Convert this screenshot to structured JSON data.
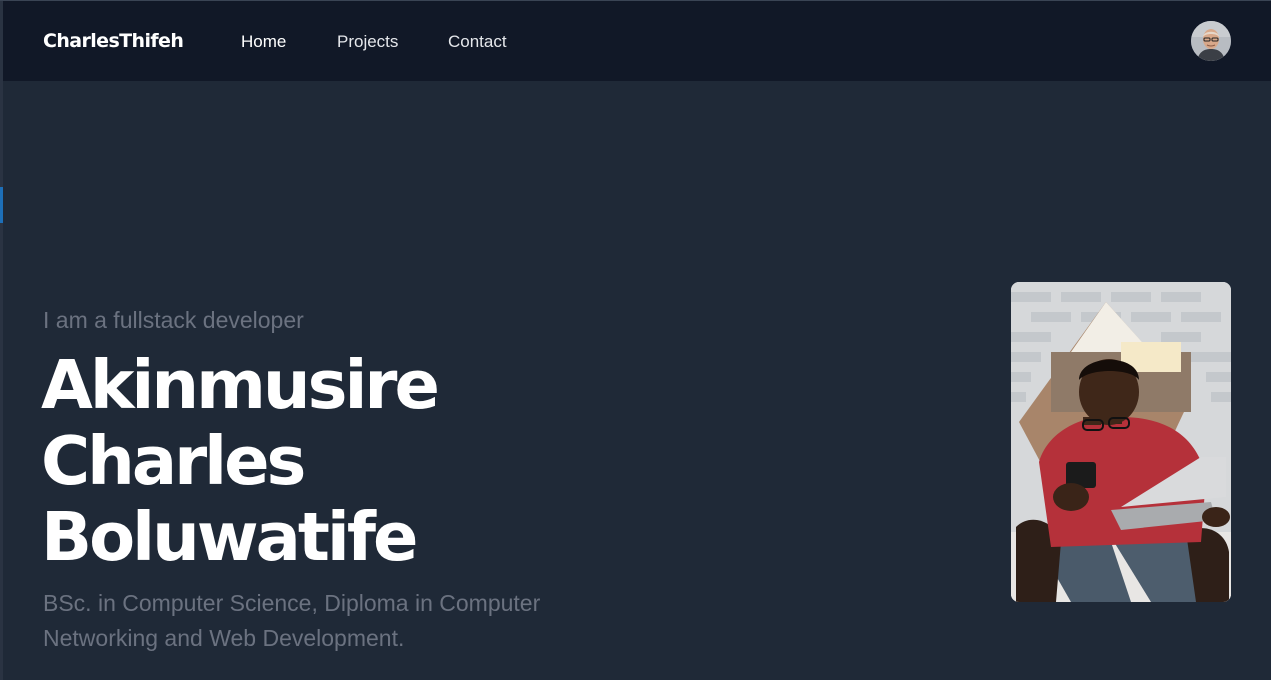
{
  "nav": {
    "brand": "CharlesThifeh",
    "links": [
      {
        "label": "Home"
      },
      {
        "label": "Projects"
      },
      {
        "label": "Contact"
      }
    ]
  },
  "hero": {
    "kicker": "I am a fullstack developer",
    "name_lines": [
      "Akinmusire",
      "Charles",
      "Boluwatife"
    ],
    "description": "BSc. in Computer Science, Diploma in Computer Networking and Web Development."
  },
  "colors": {
    "background": "#1f2937",
    "navbar": "#111827",
    "muted_text": "#6b7280",
    "heading": "#ffffff"
  }
}
